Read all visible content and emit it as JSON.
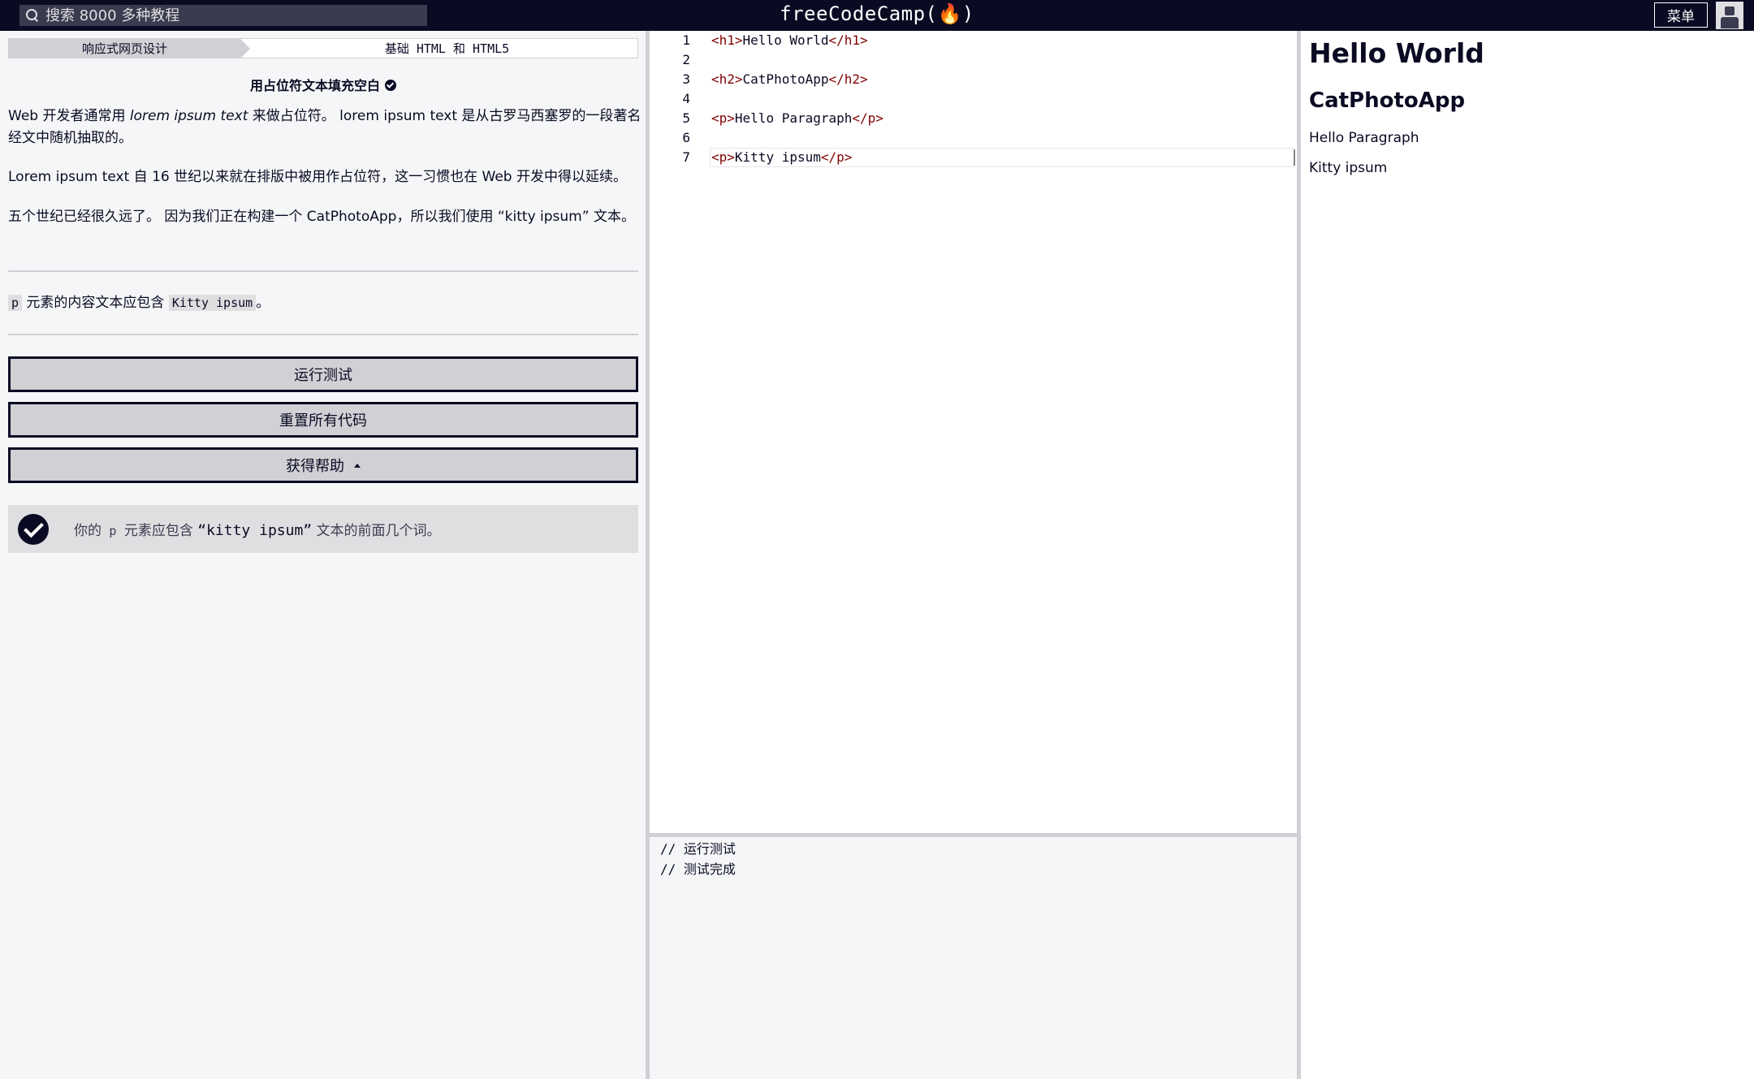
{
  "nav": {
    "search_placeholder": "搜索 8000 多种教程",
    "brand": "freeCodeCamp",
    "brand_flame": "(🔥)",
    "menu_label": "菜单"
  },
  "breadcrumb": {
    "superblock": "响应式网页设计",
    "block": "基础 HTML 和 HTML5"
  },
  "challenge": {
    "title": "用占位符文本填充空白",
    "description": {
      "p1_a": "Web 开发者通常用 ",
      "p1_em": "lorem ipsum text",
      "p1_b": " 来做占位符。 lorem ipsum text 是从古罗马西塞罗的一段著名经文中随机抽取的。",
      "p2": "Lorem ipsum text 自 16 世纪以来就在排版中被用作占位符，这一习惯也在 Web 开发中得以延续。",
      "p3": "五个世纪已经很久远了。 因为我们正在构建一个 CatPhotoApp，所以我们使用 “kitty ipsum” 文本。"
    },
    "hint": {
      "code1": "p",
      "text": " 元素的内容文本应包含 ",
      "code2": "Kitty ipsum",
      "end": "。"
    }
  },
  "buttons": {
    "run": "运行测试",
    "reset": "重置所有代码",
    "help": "获得帮助"
  },
  "test": {
    "prefix": "你的 ",
    "code": "p",
    "middle": " 元素应包含 ",
    "quote": "“kitty ipsum”",
    "suffix": " 文本的前面几个词。",
    "passed": true
  },
  "editor": {
    "lines": [
      {
        "num": "1",
        "open": "<h1>",
        "text": "Hello World",
        "close": "</h1>"
      },
      {
        "num": "2",
        "open": "",
        "text": "",
        "close": ""
      },
      {
        "num": "3",
        "open": "<h2>",
        "text": "CatPhotoApp",
        "close": "</h2>"
      },
      {
        "num": "4",
        "open": "",
        "text": "",
        "close": ""
      },
      {
        "num": "5",
        "open": "<p>",
        "text": "Hello Paragraph",
        "close": "</p>"
      },
      {
        "num": "6",
        "open": "",
        "text": "",
        "close": ""
      },
      {
        "num": "7",
        "open": "<p>",
        "text": "Kitty ipsum",
        "close": "</p>"
      }
    ]
  },
  "console": {
    "line1": "// 运行测试",
    "line2": "// 测试完成"
  },
  "preview": {
    "h1": "Hello World",
    "h2": "CatPhotoApp",
    "p1": "Hello Paragraph",
    "p2": "Kitty ipsum"
  },
  "colors": {
    "nav_bg": "#0a0a23",
    "panel_bg": "#f5f6f7",
    "button_bg": "#d0d0d5",
    "tag_color": "#800000"
  }
}
